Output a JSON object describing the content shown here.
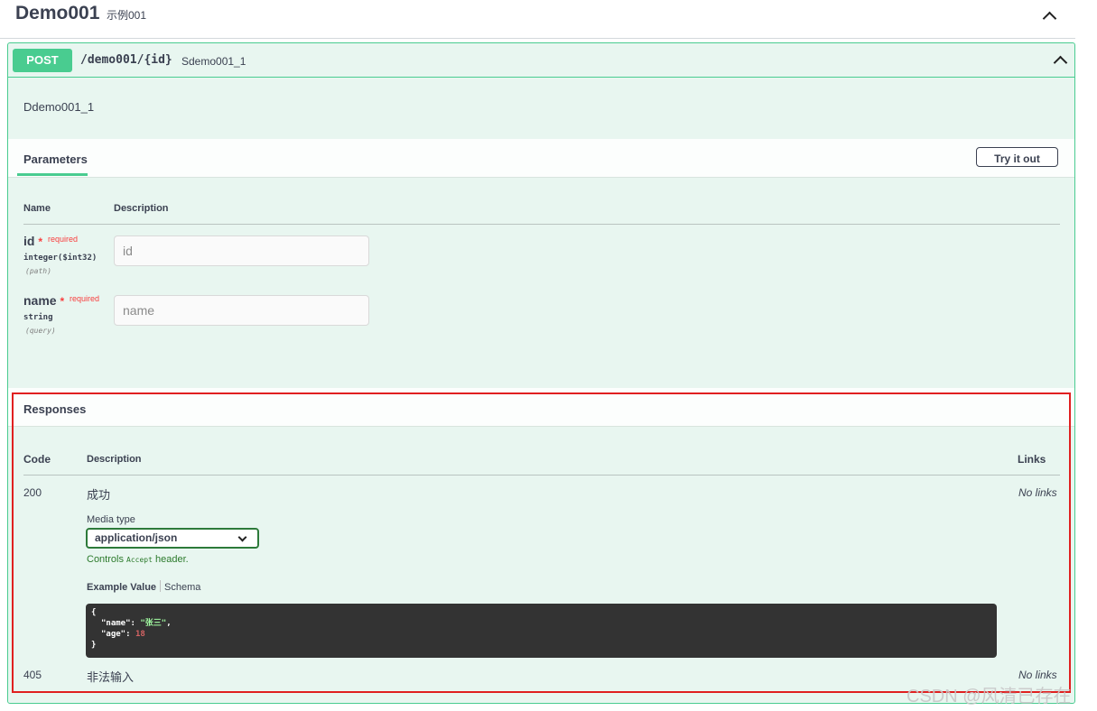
{
  "tag": {
    "title": "Demo001",
    "description": "示例001"
  },
  "operation": {
    "method": "POST",
    "path": "/demo001/{id}",
    "summary": "Sdemo001_1",
    "description": "Ddemo001_1"
  },
  "parameters": {
    "title": "Parameters",
    "try_button": "Try it out",
    "col_name": "Name",
    "col_description": "Description",
    "required_star": "*",
    "required_label": "required",
    "items": [
      {
        "name": "id",
        "type": "integer($int32)",
        "in": "(path)",
        "placeholder": "id"
      },
      {
        "name": "name",
        "type": "string",
        "in": "(query)",
        "placeholder": "name"
      }
    ]
  },
  "responses": {
    "title": "Responses",
    "col_code": "Code",
    "col_description": "Description",
    "col_links": "Links",
    "items": [
      {
        "code": "200",
        "description": "成功",
        "links": "No links",
        "media_type_label": "Media type",
        "media_type": "application/json",
        "controls_prefix": "Controls",
        "controls_code": "Accept",
        "controls_suffix": "header.",
        "example_tab": "Example Value",
        "schema_tab": "Schema",
        "example": {
          "open": "{",
          "name_key": "\"name\"",
          "name_value": "\"张三\"",
          "age_key": "\"age\"",
          "age_value": "18",
          "close": "}"
        }
      },
      {
        "code": "405",
        "description": "非法输入",
        "links": "No links"
      }
    ]
  },
  "watermark": "CSDN @风清已存在",
  "colors": {
    "post": "#49cc90",
    "highlight_box": "#e02020",
    "background": "#e8f6f0"
  }
}
